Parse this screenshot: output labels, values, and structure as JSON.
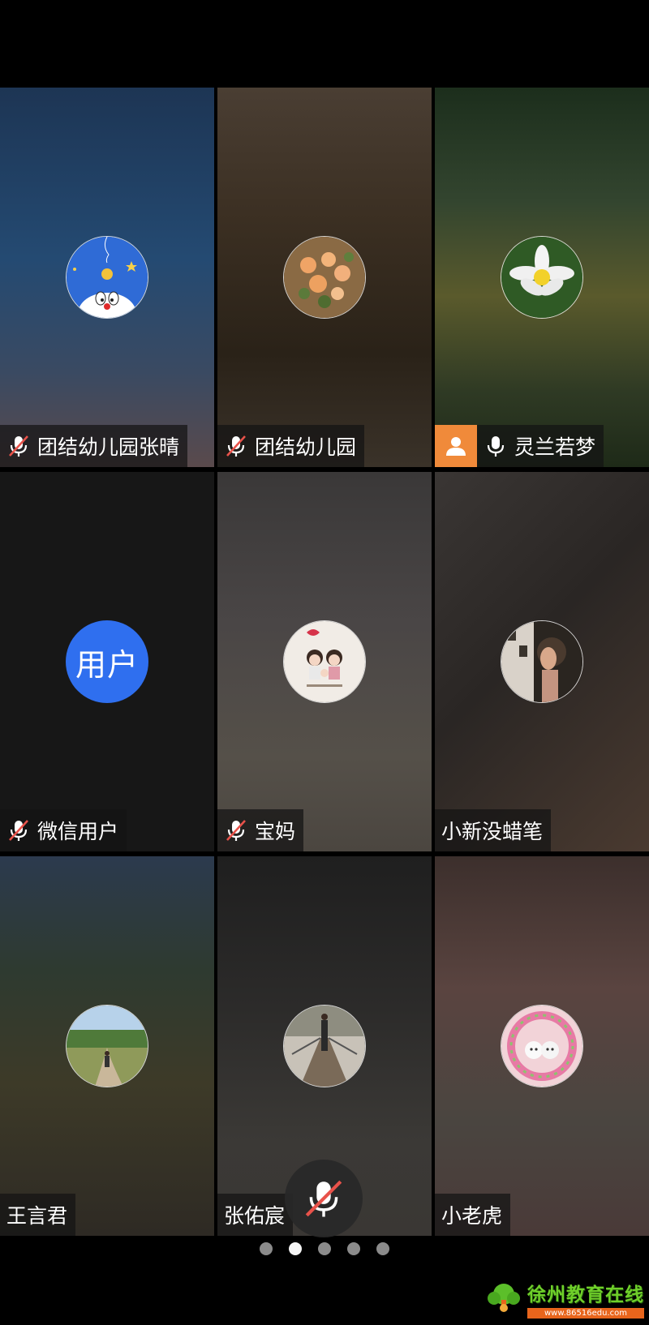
{
  "participants": [
    {
      "name": "团结幼儿园张晴",
      "muted": true,
      "host": false,
      "avatar": "doraemon-avatar"
    },
    {
      "name": "团结幼儿园",
      "muted": true,
      "host": false,
      "avatar": "roses-avatar"
    },
    {
      "name": "灵兰若梦",
      "muted": false,
      "host": true,
      "avatar": "lotus-avatar"
    },
    {
      "name": "微信用户",
      "muted": true,
      "host": false,
      "avatar": "text-avatar",
      "avatar_text": "用户"
    },
    {
      "name": "宝妈",
      "muted": true,
      "host": false,
      "avatar": "cartoon-family-avatar"
    },
    {
      "name": "小新没蜡笔",
      "muted": null,
      "host": false,
      "avatar": "portrait-avatar"
    },
    {
      "name": "王言君",
      "muted": null,
      "host": false,
      "avatar": "path-photo-avatar"
    },
    {
      "name": "张佑宸",
      "muted": null,
      "host": false,
      "avatar": "bridge-photo-avatar"
    },
    {
      "name": "小老虎",
      "muted": null,
      "host": false,
      "avatar": "kittens-wreath-avatar"
    }
  ],
  "pagination": {
    "pages": 5,
    "current": 2
  },
  "watermark": {
    "title": "徐州教育在线",
    "url": "www.86516edu.com"
  },
  "colors": {
    "host_badge": "#f08a3a",
    "text_avatar": "#2f6fef",
    "muted_slash": "#e8524a"
  }
}
